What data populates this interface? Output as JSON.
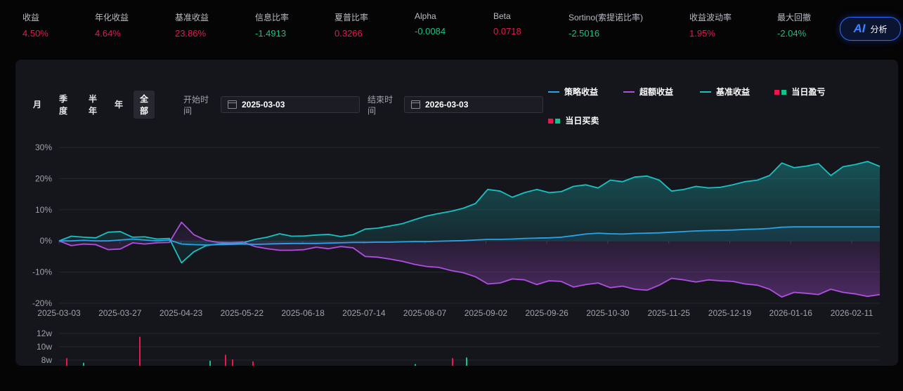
{
  "metrics": [
    {
      "label": "收益",
      "value": "4.50%",
      "color": "#e8174e"
    },
    {
      "label": "年化收益",
      "value": "4.64%",
      "color": "#e8174e"
    },
    {
      "label": "基准收益",
      "value": "23.86%",
      "color": "#e8174e"
    },
    {
      "label": "信息比率",
      "value": "-1.4913",
      "color": "#14c08c"
    },
    {
      "label": "夏普比率",
      "value": "0.3266",
      "color": "#e8174e"
    },
    {
      "label": "Alpha",
      "value": "-0.0084",
      "color": "#14c08c"
    },
    {
      "label": "Beta",
      "value": "0.0718",
      "color": "#e8174e"
    },
    {
      "label": "Sortino(索提诺比率)",
      "value": "-2.5016",
      "color": "#14c08c"
    },
    {
      "label": "收益波动率",
      "value": "1.95%",
      "color": "#e8174e"
    },
    {
      "label": "最大回撤",
      "value": "-2.04%",
      "color": "#14c08c"
    }
  ],
  "ai_button": {
    "icon": "AI",
    "label": "分析"
  },
  "range_buttons": [
    "月",
    "季\n度",
    "半\n年",
    "年",
    "全\n部"
  ],
  "active_range": "全部",
  "date_filter": {
    "start_label": "开始时\n间",
    "start_value": "2025-03-03",
    "end_label": "结束时\n间",
    "end_value": "2026-03-03"
  },
  "legend": {
    "strategy": "策略收益",
    "excess": "超额收益",
    "benchmark": "基准收益",
    "daily_pnl": "当日盈亏",
    "daily_trade": "当日买卖"
  },
  "colors": {
    "strategy": "#2aa2e8",
    "excess": "#b04ee0",
    "benchmark": "#18c2c2",
    "up": "#e8174e",
    "down": "#14c08c"
  },
  "chart_data": [
    {
      "type": "line",
      "x_ticks": [
        "2025-03-03",
        "2025-03-27",
        "2025-04-23",
        "2025-05-22",
        "2025-06-18",
        "2025-07-14",
        "2025-08-07",
        "2025-09-02",
        "2025-09-26",
        "2025-10-30",
        "2025-11-25",
        "2025-12-19",
        "2026-01-16",
        "2026-02-11"
      ],
      "y_ticks": [
        "30%",
        "20%",
        "10%",
        "0%",
        "-10%",
        "-20%"
      ],
      "ylim": [
        -20,
        30
      ],
      "y_unit": "%",
      "series": [
        {
          "name": "基准收益",
          "values": [
            0,
            1.5,
            1.2,
            1.0,
            2.8,
            3.0,
            1.2,
            1.3,
            0.6,
            0.8,
            -7.0,
            -3.5,
            -1.5,
            -1.0,
            -0.8,
            -0.6,
            0.5,
            1.2,
            2.3,
            1.5,
            1.6,
            1.9,
            2.1,
            1.4,
            2.0,
            3.8,
            4.1,
            4.8,
            5.5,
            6.8,
            8.0,
            8.8,
            9.5,
            10.5,
            12.0,
            16.5,
            16.0,
            14.0,
            15.5,
            16.5,
            15.5,
            15.8,
            17.5,
            18.0,
            17.0,
            19.5,
            19.0,
            20.5,
            20.8,
            19.5,
            16.0,
            16.5,
            17.5,
            17.0,
            17.2,
            18.0,
            19.0,
            19.5,
            21.0,
            25.0,
            23.5,
            24.0,
            24.8,
            21.0,
            23.8,
            24.5,
            25.5,
            23.9
          ]
        },
        {
          "name": "超额收益",
          "values": [
            0,
            -1.5,
            -1.0,
            -1.2,
            -2.8,
            -2.6,
            -0.6,
            -1.0,
            -0.6,
            -0.5,
            6.0,
            2.0,
            0.2,
            -0.5,
            -0.6,
            -0.4,
            -1.8,
            -2.5,
            -3.0,
            -3.0,
            -2.8,
            -2.0,
            -2.5,
            -1.8,
            -2.2,
            -5.0,
            -5.2,
            -5.8,
            -6.5,
            -7.5,
            -8.2,
            -8.5,
            -9.5,
            -10.2,
            -11.5,
            -13.8,
            -13.5,
            -12.2,
            -12.5,
            -14.0,
            -12.8,
            -13.0,
            -14.8,
            -14.0,
            -13.5,
            -15.0,
            -14.5,
            -15.5,
            -15.8,
            -14.2,
            -12.0,
            -12.5,
            -13.2,
            -12.5,
            -12.8,
            -13.0,
            -13.8,
            -14.2,
            -15.5,
            -18.0,
            -16.5,
            -16.8,
            -17.2,
            -15.5,
            -16.5,
            -17.0,
            -17.8,
            -17.2
          ]
        },
        {
          "name": "策略收益",
          "values": [
            0,
            0,
            0.2,
            0,
            0,
            0.3,
            0.6,
            0.3,
            0,
            0.3,
            -1.0,
            -1.2,
            -1.3,
            -1.2,
            -1.1,
            -1.0,
            -1.1,
            -1.0,
            -0.9,
            -0.8,
            -0.8,
            -0.8,
            -0.7,
            -0.6,
            -0.5,
            -0.5,
            -0.4,
            -0.4,
            -0.3,
            -0.2,
            -0.2,
            -0.1,
            0,
            0.1,
            0.3,
            0.5,
            0.5,
            0.6,
            0.8,
            0.9,
            1.0,
            1.2,
            1.7,
            2.2,
            2.5,
            2.3,
            2.2,
            2.4,
            2.5,
            2.6,
            2.8,
            3.0,
            3.2,
            3.3,
            3.4,
            3.5,
            3.7,
            3.8,
            4.0,
            4.4,
            4.5,
            4.5,
            4.5,
            4.5,
            4.5,
            4.5,
            4.5,
            4.5
          ]
        }
      ]
    },
    {
      "type": "bar",
      "y_ticks": [
        "12w",
        "10w",
        "8w"
      ],
      "ylim": [
        6,
        12
      ],
      "series": [
        {
          "name": "当日盈亏",
          "color": "#e8174e",
          "values": [
            8.3,
            0,
            11.5,
            0,
            8.8,
            8.1,
            7.8,
            0,
            8.3,
            0
          ]
        },
        {
          "name": "当日买卖",
          "color": "#14c08c",
          "values": [
            0,
            7.6,
            0,
            7.9,
            0,
            0,
            0,
            7.4,
            0,
            8.4
          ]
        }
      ]
    }
  ]
}
